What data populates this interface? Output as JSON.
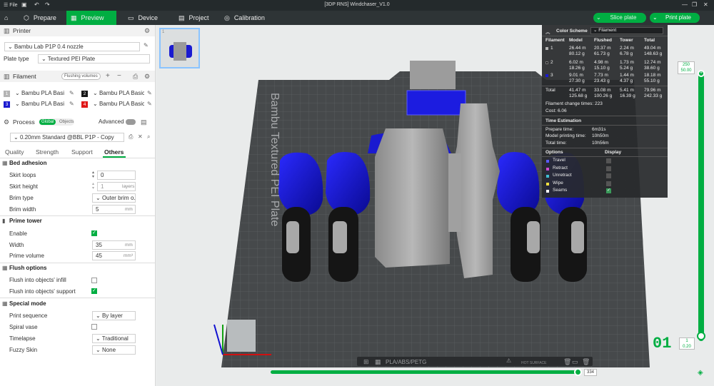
{
  "app": {
    "title": "[3DP RNS] Windchaser_V1.0",
    "file_menu": "File"
  },
  "nav": {
    "tabs": [
      {
        "label": "Prepare"
      },
      {
        "label": "Preview"
      },
      {
        "label": "Device"
      },
      {
        "label": "Project"
      },
      {
        "label": "Calibration"
      }
    ],
    "slice_label": "Slice plate",
    "print_label": "Print plate"
  },
  "sidebar": {
    "printer_header": "Printer",
    "printer_value": "Bambu Lab P1P 0.4 nozzle",
    "plate_type_label": "Plate type",
    "plate_type_value": "Textured PEI Plate",
    "filament_header": "Filament",
    "flushing_volumes": "Flushing volumes",
    "filaments": [
      {
        "num": "1",
        "name": "Bambu PLA Basic",
        "color": "#b4b4b4"
      },
      {
        "num": "2",
        "name": "Bambu PLA Basic",
        "color": "#161616"
      },
      {
        "num": "3",
        "name": "Bambu PLA Basic",
        "color": "#1a1ad0"
      },
      {
        "num": "4",
        "name": "Bambu PLA Basic",
        "color": "#e01818"
      }
    ],
    "process_header": "Process",
    "process_global": "Global",
    "process_objects": "Objects",
    "advanced_label": "Advanced",
    "process_value": "0.20mm Standard @BBL P1P - Copy",
    "tabs": [
      "Quality",
      "Strength",
      "Support",
      "Others"
    ],
    "groups": {
      "bed_adhesion": "Bed adhesion",
      "prime_tower": "Prime tower",
      "flush_options": "Flush options",
      "special_mode": "Special mode"
    },
    "settings": {
      "skirt_loops": {
        "label": "Skirt loops",
        "value": "0"
      },
      "skirt_height": {
        "label": "Skirt height",
        "value": "1",
        "unit": "layers"
      },
      "brim_type": {
        "label": "Brim type",
        "value": "Outer brim o..."
      },
      "brim_width": {
        "label": "Brim width",
        "value": "5",
        "unit": "mm"
      },
      "enable": {
        "label": "Enable"
      },
      "width": {
        "label": "Width",
        "value": "35",
        "unit": "mm"
      },
      "prime_volume": {
        "label": "Prime volume",
        "value": "45",
        "unit": "mm³"
      },
      "flush_infill": {
        "label": "Flush into objects' infill"
      },
      "flush_support": {
        "label": "Flush into objects' support"
      },
      "print_sequence": {
        "label": "Print sequence",
        "value": "By layer"
      },
      "spiral_vase": {
        "label": "Spiral vase"
      },
      "timelapse": {
        "label": "Timelapse",
        "value": "Traditional"
      },
      "fuzzy_skin": {
        "label": "Fuzzy Skin",
        "value": "None"
      }
    }
  },
  "overlay": {
    "color_scheme_label": "Color Scheme",
    "color_scheme_value": "Filament",
    "headers": [
      "Filament",
      "Model",
      "Flushed",
      "Tower",
      "Total"
    ],
    "rows": [
      {
        "id": "1",
        "color": "#b4b4b4",
        "model": [
          "26.44 m",
          "80.12 g"
        ],
        "flushed": [
          "20.37 m",
          "61.73 g"
        ],
        "tower": [
          "2.24 m",
          "6.78 g"
        ],
        "total": [
          "49.04 m",
          "148.63 g"
        ]
      },
      {
        "id": "2",
        "color": "#161616",
        "model": [
          "6.02 m",
          "18.26 g"
        ],
        "flushed": [
          "4.98 m",
          "15.10 g"
        ],
        "tower": [
          "1.73 m",
          "5.24 g"
        ],
        "total": [
          "12.74 m",
          "38.60 g"
        ]
      },
      {
        "id": "3",
        "color": "#1a1ad0",
        "model": [
          "9.01 m",
          "27.30 g"
        ],
        "flushed": [
          "7.73 m",
          "23.43 g"
        ],
        "tower": [
          "1.44 m",
          "4.37 g"
        ],
        "total": [
          "18.18 m",
          "55.10 g"
        ]
      }
    ],
    "total_row": {
      "label": "Total",
      "model": [
        "41.47 m",
        "125.68 g"
      ],
      "flushed": [
        "33.08 m",
        "100.26 g"
      ],
      "tower": [
        "5.41 m",
        "16.39 g"
      ],
      "total": [
        "79.96 m",
        "242.33 g"
      ]
    },
    "change_times": "Filament change times:  223",
    "cost": "Cost:  6.06",
    "time_header": "Time Estimation",
    "prepare_time": {
      "label": "Prepare time:",
      "value": "6m31s"
    },
    "model_time": {
      "label": "Model printing time:",
      "value": "10h50m"
    },
    "total_time": {
      "label": "Total time:",
      "value": "10h56m"
    },
    "options_header": "Options",
    "display_header": "Display",
    "options": [
      {
        "label": "Travel",
        "color": "#5a5aff",
        "checked": false
      },
      {
        "label": "Retract",
        "color": "#d04ad0",
        "checked": false
      },
      {
        "label": "Unretract",
        "color": "#40c0d0",
        "checked": false
      },
      {
        "label": "Wipe",
        "color": "#f0e040",
        "checked": false
      },
      {
        "label": "Seams",
        "color": "#ffffff",
        "checked": true
      }
    ]
  },
  "viewport": {
    "plate_label": "Bambu Textured PEI Plate",
    "plate_thumb_number": "1",
    "bed_text": "PLA/ABS/PETG",
    "hot_surface": "HOT SURFACE",
    "layer_top_label": "250\n50.00",
    "layer_top_1": "250",
    "layer_top_2": "50.00",
    "layer_bottom_1": "1",
    "layer_bottom_2": "0.20",
    "current_layer_big": "01",
    "hslider_value": "334"
  }
}
